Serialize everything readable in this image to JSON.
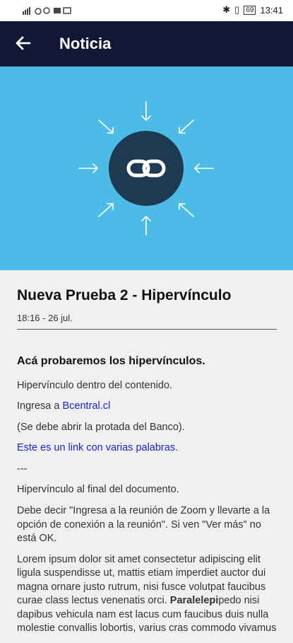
{
  "status": {
    "time": "13:41",
    "battery": "69"
  },
  "appbar": {
    "title": "Noticia"
  },
  "article": {
    "title": "Nueva Prueba 2 - Hipervínculo",
    "meta": "18:16 - 26 jul.",
    "heading": "Acá probaremos los hipervínculos.",
    "p1": "Hipervínculo dentro del contenido.",
    "p2_prefix": "Ingresa a ",
    "p2_link": "Bcentral.cl",
    "p3": "(Se debe abrir la protada del Banco).",
    "p4_link": "Este es un link con varias palabras.",
    "p5": "---",
    "p6": "Hipervínculo al final del documento.",
    "p7": "Debe decir \"Ingresa a la reunión de Zoom y llevarte a la opción de conexión a la reunión\". Si ven \"Ver más\" no está OK.",
    "p8_a": "Lorem ipsum dolor sit amet consectetur adipiscing elit ligula suspendisse ut, mattis etiam imperdiet auctor dui magna ornare justo rutrum, nisi fusce volutpat faucibus curae class lectus venenatis orci. ",
    "p8_bold": "Paralelepi",
    "p8_b": "pedo nisi dapibus vehicula nam est lacus cum faucibus duis nulla molestie convallis lobortis, varius cras commodo vivamus"
  },
  "colors": {
    "appbar": "#111836",
    "hero": "#4cbbe7",
    "circle": "#1d3a52",
    "link": "#1a22d6"
  }
}
